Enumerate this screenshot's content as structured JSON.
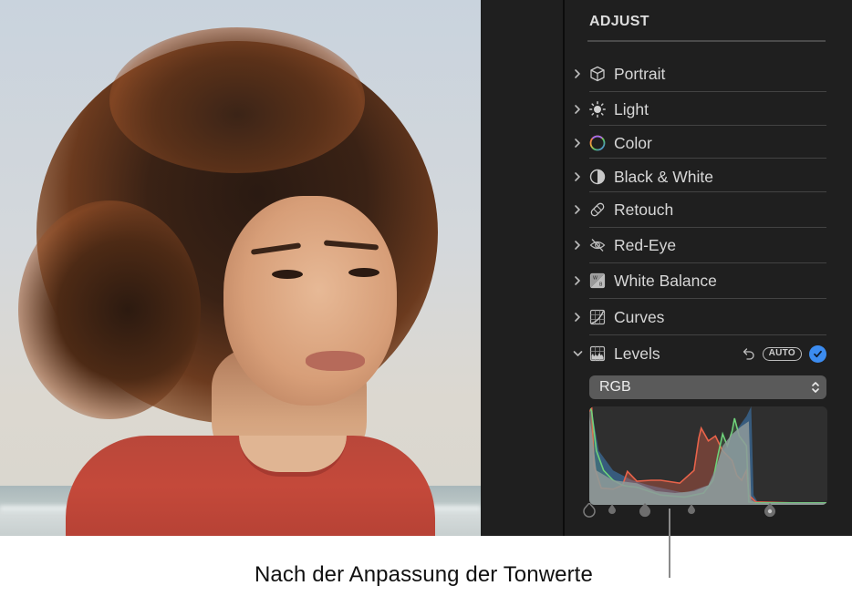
{
  "photo": {
    "description": "Portrait of a woman with curly auburn hair wearing a red t-shirt, beach background"
  },
  "sidebar": {
    "section_title": "ADJUST",
    "items": [
      {
        "label": "Portrait",
        "icon": "cube-icon",
        "expanded": false
      },
      {
        "label": "Light",
        "icon": "sun-icon",
        "expanded": false
      },
      {
        "label": "Color",
        "icon": "color-ring-icon",
        "expanded": false
      },
      {
        "label": "Black & White",
        "icon": "half-circle-icon",
        "expanded": false
      },
      {
        "label": "Retouch",
        "icon": "bandage-icon",
        "expanded": false
      },
      {
        "label": "Red-Eye",
        "icon": "eye-slash-icon",
        "expanded": false
      },
      {
        "label": "White Balance",
        "icon": "white-balance-icon",
        "expanded": false
      },
      {
        "label": "Curves",
        "icon": "curves-icon",
        "expanded": false
      },
      {
        "label": "Levels",
        "icon": "levels-icon",
        "expanded": true
      }
    ],
    "levels": {
      "auto_label": "AUTO",
      "enabled": true,
      "channel": "RGB",
      "handles": [
        {
          "name": "black-point",
          "value": 0
        },
        {
          "name": "shadows",
          "value": 0.1
        },
        {
          "name": "midtones",
          "value": 0.24
        },
        {
          "name": "highlights",
          "value": 0.44
        },
        {
          "name": "white-point",
          "value": 0.78
        }
      ]
    },
    "colors": {
      "accent": "#3c8cf0",
      "histogram_red": "#e8634a",
      "histogram_green": "#6fd17a",
      "histogram_blue": "#3a6e9e",
      "histogram_luma": "#8e9a9a"
    }
  },
  "caption": {
    "text": "Nach der Anpassung der Tonwerte"
  }
}
